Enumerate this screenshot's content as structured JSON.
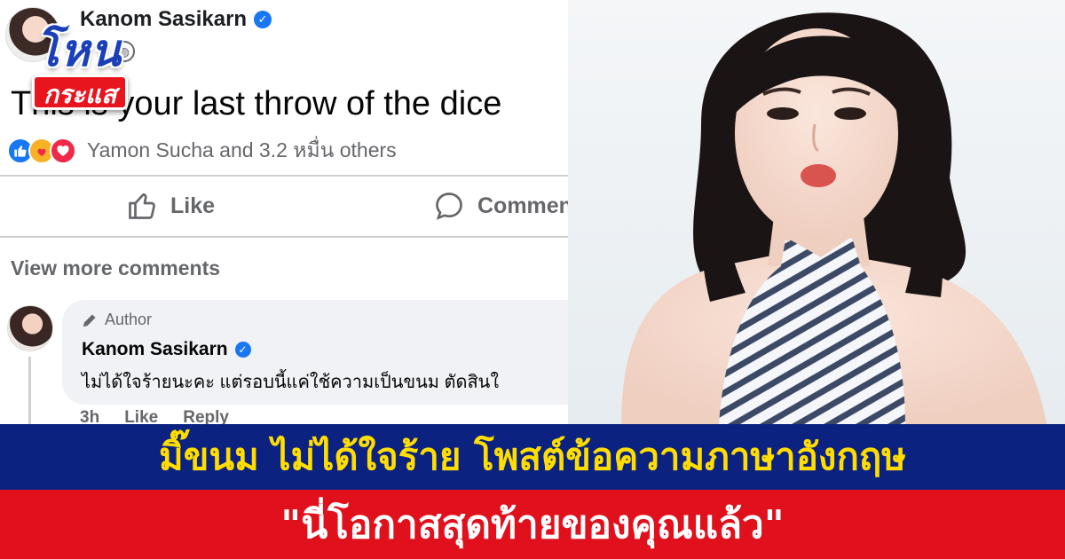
{
  "logo": {
    "top_text": "โหน",
    "bottom_text": "กระแส"
  },
  "post": {
    "author": "Kanom Sasikarn",
    "text": "This is your last throw of the dice",
    "reactions_text": "Yamon Sucha and 3.2 หมื่น others",
    "actions": {
      "like": "Like",
      "comment": "Comment"
    },
    "view_more": "View more comments"
  },
  "comment": {
    "author_tag": "Author",
    "name": "Kanom Sasikarn",
    "text": "ไม่ได้ใจร้ายนะคะ แต่รอบนี้แค่ใช้ความเป็นขนม ตัดสินใ",
    "meta": {
      "time": "3h",
      "like": "Like",
      "reply": "Reply"
    }
  },
  "headline": {
    "line1": "มิ๊ขนม ไม่ได้ใจร้าย โพสต์ข้อความภาษาอังกฤษ",
    "line2": "\"นี่โอกาสสุดท้ายของคุณแล้ว\""
  },
  "colors": {
    "facebook_blue": "#1877f2",
    "banner_blue": "#0c2280",
    "banner_yellow_text": "#ffdd00",
    "banner_red": "#e0101c"
  },
  "icons": [
    "verified-badge-icon",
    "globe-icon",
    "like-reaction-icon",
    "care-reaction-icon",
    "love-reaction-icon",
    "thumbs-up-icon",
    "comment-icon",
    "pencil-icon"
  ]
}
